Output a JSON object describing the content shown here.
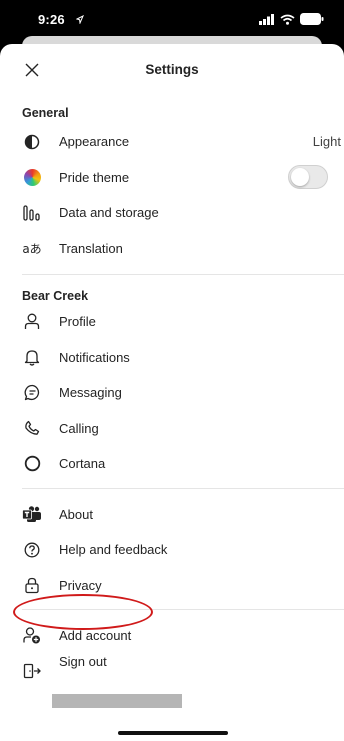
{
  "status_bar": {
    "time": "9:26"
  },
  "header": {
    "title": "Settings"
  },
  "general": {
    "title": "General",
    "items": [
      {
        "label": "Appearance",
        "value": "Light"
      },
      {
        "label": "Pride theme"
      },
      {
        "label": "Data and storage"
      },
      {
        "label": "Translation"
      }
    ]
  },
  "org": {
    "title": "Bear Creek",
    "items": [
      {
        "label": "Profile"
      },
      {
        "label": "Notifications"
      },
      {
        "label": "Messaging"
      },
      {
        "label": "Calling"
      },
      {
        "label": "Cortana"
      }
    ]
  },
  "about": {
    "items": [
      {
        "label": "About"
      },
      {
        "label": "Help and feedback"
      },
      {
        "label": "Privacy"
      }
    ]
  },
  "account": {
    "items": [
      {
        "label": "Add account"
      },
      {
        "label": "Sign out"
      }
    ]
  },
  "pride_theme_enabled": false,
  "colors": {
    "highlight": "#d01a1a",
    "text": "#242424"
  }
}
